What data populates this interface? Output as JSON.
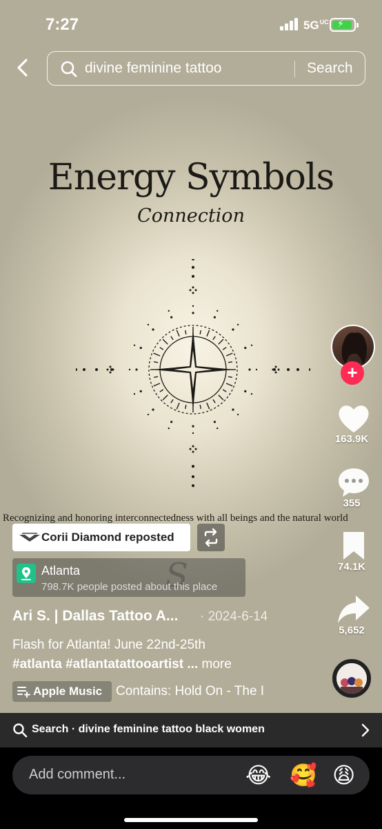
{
  "status": {
    "time": "7:27",
    "network": "5G",
    "network_sub": "UC"
  },
  "search": {
    "query": "divine feminine tattoo",
    "button": "Search"
  },
  "poster": {
    "title": "Energy Symbols",
    "subtitle": "Connection",
    "caption": "Recognizing and honoring interconnectedness with all beings and the natural world",
    "watermark": "S"
  },
  "rail": {
    "likes": "163.9K",
    "comments": "355",
    "saves": "74.1K",
    "shares": "5,652",
    "follow_symbol": "+"
  },
  "repost": {
    "text": "Corii Diamond reposted"
  },
  "location": {
    "name": "Atlanta",
    "subtitle": "798.7K people posted about this place"
  },
  "post": {
    "author": "Ari S. | Dallas Tattoo A...",
    "date": "· 2024-6-14",
    "line1": "Flash for Atlanta! June 22nd-25th",
    "hashtags": "#atlanta #atlantatattooartist ...",
    "more": " more"
  },
  "music": {
    "label": "Apple Music",
    "song": "Contains: Hold On - The I"
  },
  "related": {
    "text": "Search · divine feminine tattoo black women"
  },
  "comment": {
    "placeholder": "Add comment...",
    "emojis": [
      "😂",
      "🥰",
      "😩"
    ]
  },
  "colors": {
    "follow": "#fe2c55",
    "location_pin": "#20c28a",
    "battery": "#3fd24a"
  }
}
